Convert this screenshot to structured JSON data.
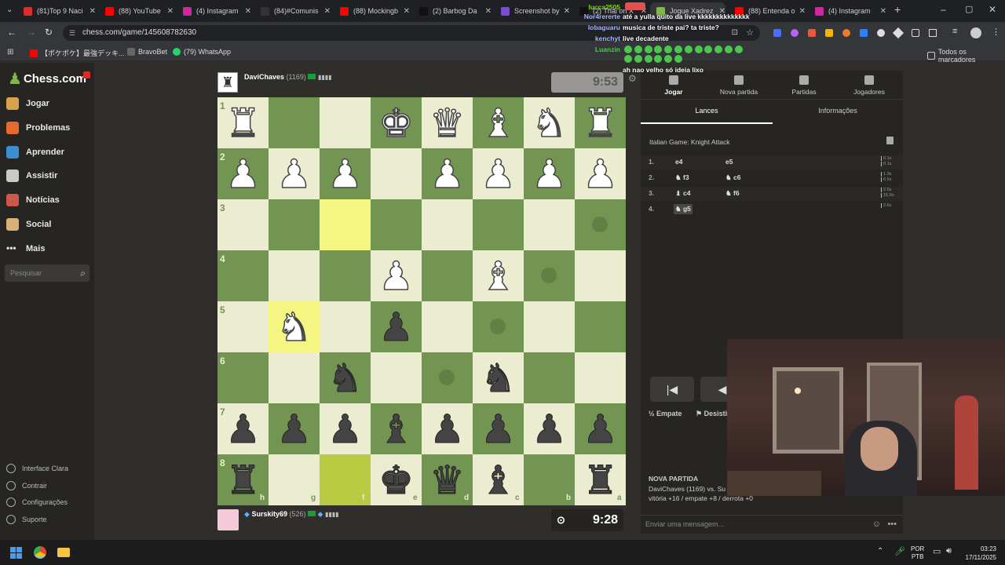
{
  "browser": {
    "tabs": [
      {
        "label": "(81)Top 9 Naci",
        "color": "#e02b2b",
        "icon": "tiktok-icon"
      },
      {
        "label": "(88) YouTube",
        "color": "#ff0000",
        "icon": "youtube-icon"
      },
      {
        "label": "(4) Instagram",
        "color": "#d6249f",
        "icon": "instagram-icon"
      },
      {
        "label": "(84)#Comunis",
        "color": "#333333",
        "icon": "tiktok-icon"
      },
      {
        "label": "(88) Mockingb",
        "color": "#ff0000",
        "icon": "youtube-icon"
      },
      {
        "label": "(2) Barbog Da",
        "color": "#111111",
        "icon": "x-icon"
      },
      {
        "label": "Screenshot by",
        "color": "#7b4bd6",
        "icon": "lightshot-icon"
      },
      {
        "label": "(2) Thai on X",
        "color": "#111111",
        "icon": "x-icon"
      },
      {
        "label": "Jogue Xadrez",
        "color": "#81b64c",
        "icon": "chess-icon"
      },
      {
        "label": "(88) Entenda o",
        "color": "#ff0000",
        "icon": "youtube-icon"
      },
      {
        "label": "(4) Instagram",
        "color": "#d6249f",
        "icon": "instagram-icon"
      }
    ],
    "url": "chess.com/game/145608782630",
    "bookmarks": [
      "【ポケポケ】最強デッキ...",
      "BravoBet",
      "(79) WhatsApp"
    ],
    "all_bookmarks": "Todos os marcadores"
  },
  "sidebar": {
    "logo": "Chess.com",
    "items": [
      "Jogar",
      "Problemas",
      "Aprender",
      "Assistir",
      "Notícias",
      "Social",
      "Mais"
    ],
    "search_placeholder": "Pesquisar",
    "footer": [
      "Interface Clara",
      "Contrair",
      "Configurações",
      "Suporte"
    ]
  },
  "game": {
    "top_player": {
      "name": "DaviChaves",
      "rating": "(1169)",
      "clock": "9:53"
    },
    "bottom_player": {
      "name": "Surskity69",
      "rating": "(526)",
      "clock": "9:28"
    },
    "ranks": [
      "1",
      "2",
      "3",
      "4",
      "5",
      "6",
      "7",
      "8"
    ],
    "files": [
      "h",
      "g",
      "f",
      "e",
      "d",
      "c",
      "b",
      "a"
    ]
  },
  "panel": {
    "tabs": [
      "Jogar",
      "Nova partida",
      "Partidas",
      "Jogadores"
    ],
    "subtabs": [
      "Lances",
      "Informações"
    ],
    "opening": "Italian Game: Knight Attack",
    "moves": [
      {
        "n": "1.",
        "w": "e4",
        "b": "e5",
        "t": [
          "0.1s",
          "0.1s"
        ]
      },
      {
        "n": "2.",
        "w": "f3",
        "b": "c6",
        "t": [
          "1.3s",
          "6.5s"
        ]
      },
      {
        "n": "3.",
        "w": "c4",
        "b": "f6",
        "t": [
          "2.6s",
          "15.9s"
        ]
      },
      {
        "n": "4.",
        "w": "g5",
        "b": "",
        "t": [
          "2.6s"
        ]
      }
    ],
    "draw": "Empate",
    "resign": "Desisti",
    "new_game_title": "NOVA PARTIDA",
    "new_game_line": "DaviChaves (1169) vs. Su",
    "record": "vitória +16 / empate +8 / derrota +0",
    "chat_placeholder": "Enviar uma mensagem..."
  },
  "chat_overlay": [
    {
      "user": "lucca2505",
      "msg": "",
      "color": "#7ed321"
    },
    {
      "user": "Nor4rererte",
      "msg": "até a yulla quito da live kkkkkkkkkkkkkk",
      "color": "#9fb4ff"
    },
    {
      "user": "lobaguaru",
      "msg": "musica de triste pai? ta triste?",
      "color": "#9fb4ff"
    },
    {
      "user": "kenchyt",
      "msg": "live decadente",
      "color": "#9fb4ff"
    },
    {
      "user": "Luanzin",
      "msg": "",
      "color": "#33dd33"
    },
    {
      "user": "",
      "msg": "ah nao velho só ideia lixo",
      "color": "#ff4444"
    }
  ],
  "taskbar": {
    "lang": "POR",
    "layout": "PTB",
    "time": "03:23",
    "date": "17/11/2025"
  }
}
